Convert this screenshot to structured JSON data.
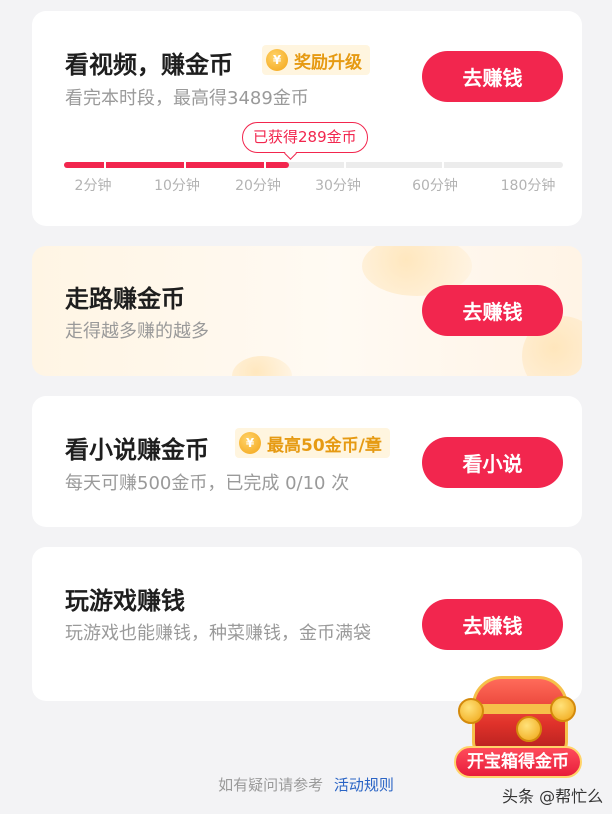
{
  "tasks": [
    {
      "title": "看视频，赚金币",
      "badge": "奖励升级",
      "subtitle": "看完本时段，最高得3489金币",
      "button": "去赚钱",
      "progress": {
        "earned_label": "已获得289金币",
        "fraction": 0.45,
        "ticks": [
          "2分钟",
          "10分钟",
          "20分钟",
          "30分钟",
          "60分钟",
          "180分钟"
        ]
      }
    },
    {
      "title": "走路赚金币",
      "subtitle": "走得越多赚的越多",
      "button": "去赚钱"
    },
    {
      "title": "看小说赚金币",
      "badge": "最高50金币/章",
      "subtitle": "每天可赚500金币，已完成 0/10 次",
      "button": "看小说"
    },
    {
      "title": "玩游戏赚钱",
      "subtitle": "玩游戏也能赚钱，种菜赚钱，金币满袋",
      "button": "去赚钱"
    }
  ],
  "coin_symbol": "¥",
  "footer": {
    "text": "如有疑问请参考",
    "link": "活动规则"
  },
  "treasure": {
    "label": "开宝箱得金币"
  },
  "watermark": "头条 @帮忙么",
  "colors": {
    "accent": "#f2264e",
    "badge_text": "#e69a12",
    "link": "#2a64c5"
  }
}
